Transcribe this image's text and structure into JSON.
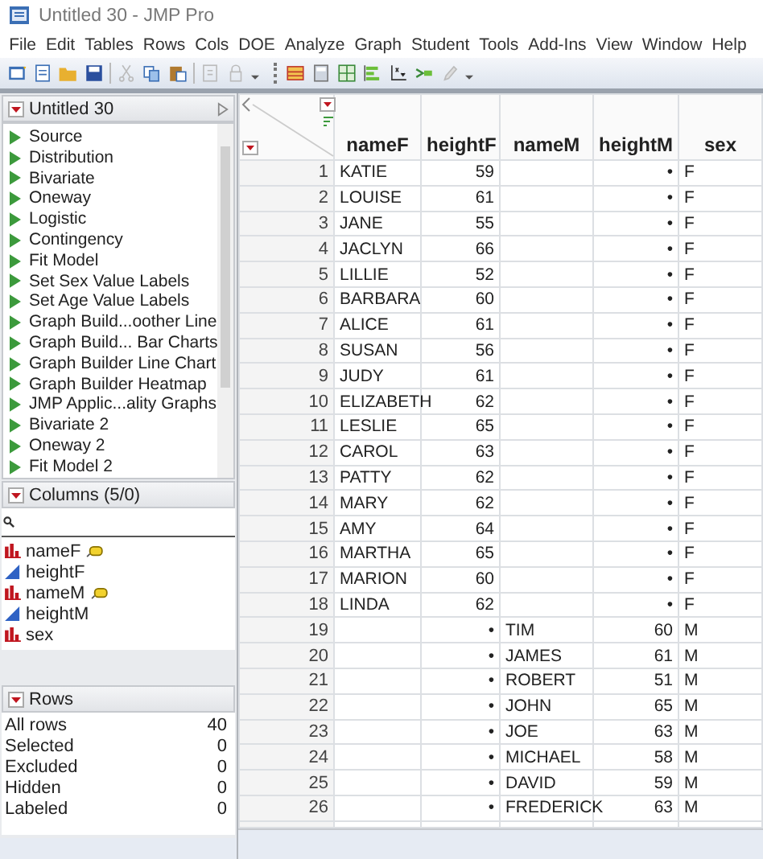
{
  "window": {
    "title": "Untitled 30 - JMP Pro"
  },
  "menu": [
    "File",
    "Edit",
    "Tables",
    "Rows",
    "Cols",
    "DOE",
    "Analyze",
    "Graph",
    "Student",
    "Tools",
    "Add-Ins",
    "View",
    "Window",
    "Help"
  ],
  "table_panel": {
    "title": "Untitled 30",
    "scripts": [
      "Source",
      "Distribution",
      "Bivariate",
      "Oneway",
      "Logistic",
      "Contingency",
      "Fit Model",
      "Set Sex Value Labels",
      "Set Age Value Labels",
      "Graph Build...oother Line",
      "Graph Build... Bar Charts",
      "Graph Builder Line Chart",
      "Graph Builder Heatmap",
      "JMP Applic...ality Graphs",
      "Bivariate 2",
      "Oneway 2",
      "Fit Model 2"
    ]
  },
  "columns_panel": {
    "title": "Columns (5/0)",
    "columns": [
      {
        "name": "nameF",
        "kind": "nominal",
        "label": true
      },
      {
        "name": "heightF",
        "kind": "continuous",
        "label": false
      },
      {
        "name": "nameM",
        "kind": "nominal",
        "label": true
      },
      {
        "name": "heightM",
        "kind": "continuous",
        "label": false
      },
      {
        "name": "sex",
        "kind": "nominal",
        "label": false
      }
    ]
  },
  "rows_panel": {
    "title": "Rows",
    "items": [
      {
        "label": "All rows",
        "count": "40"
      },
      {
        "label": "Selected",
        "count": "0"
      },
      {
        "label": "Excluded",
        "count": "0"
      },
      {
        "label": "Hidden",
        "count": "0"
      },
      {
        "label": "Labeled",
        "count": "0"
      }
    ]
  },
  "table": {
    "columns": [
      "nameF",
      "heightF",
      "nameM",
      "heightM",
      "sex"
    ],
    "rows": [
      {
        "number": "1",
        "cells": [
          "KATIE",
          "59",
          null,
          "•",
          "F"
        ]
      },
      {
        "number": "2",
        "cells": [
          "LOUISE",
          "61",
          null,
          "•",
          "F"
        ]
      },
      {
        "number": "3",
        "cells": [
          "JANE",
          "55",
          null,
          "•",
          "F"
        ]
      },
      {
        "number": "4",
        "cells": [
          "JACLYN",
          "66",
          null,
          "•",
          "F"
        ]
      },
      {
        "number": "5",
        "cells": [
          "LILLIE",
          "52",
          null,
          "•",
          "F"
        ]
      },
      {
        "number": "6",
        "cells": [
          "BARBARA",
          "60",
          null,
          "•",
          "F"
        ]
      },
      {
        "number": "7",
        "cells": [
          "ALICE",
          "61",
          null,
          "•",
          "F"
        ]
      },
      {
        "number": "8",
        "cells": [
          "SUSAN",
          "56",
          null,
          "•",
          "F"
        ]
      },
      {
        "number": "9",
        "cells": [
          "JUDY",
          "61",
          null,
          "•",
          "F"
        ]
      },
      {
        "number": "10",
        "cells": [
          "ELIZABETH",
          "62",
          null,
          "•",
          "F"
        ]
      },
      {
        "number": "11",
        "cells": [
          "LESLIE",
          "65",
          null,
          "•",
          "F"
        ]
      },
      {
        "number": "12",
        "cells": [
          "CAROL",
          "63",
          null,
          "•",
          "F"
        ]
      },
      {
        "number": "13",
        "cells": [
          "PATTY",
          "62",
          null,
          "•",
          "F"
        ]
      },
      {
        "number": "14",
        "cells": [
          "MARY",
          "62",
          null,
          "•",
          "F"
        ]
      },
      {
        "number": "15",
        "cells": [
          "AMY",
          "64",
          null,
          "•",
          "F"
        ]
      },
      {
        "number": "16",
        "cells": [
          "MARTHA",
          "65",
          null,
          "•",
          "F"
        ]
      },
      {
        "number": "17",
        "cells": [
          "MARION",
          "60",
          null,
          "•",
          "F"
        ]
      },
      {
        "number": "18",
        "cells": [
          "LINDA",
          "62",
          null,
          "•",
          "F"
        ]
      },
      {
        "number": "19",
        "cells": [
          null,
          "•",
          "TIM",
          "60",
          "M"
        ]
      },
      {
        "number": "20",
        "cells": [
          null,
          "•",
          "JAMES",
          "61",
          "M"
        ]
      },
      {
        "number": "21",
        "cells": [
          null,
          "•",
          "ROBERT",
          "51",
          "M"
        ]
      },
      {
        "number": "22",
        "cells": [
          null,
          "•",
          "JOHN",
          "65",
          "M"
        ]
      },
      {
        "number": "23",
        "cells": [
          null,
          "•",
          "JOE",
          "63",
          "M"
        ]
      },
      {
        "number": "24",
        "cells": [
          null,
          "•",
          "MICHAEL",
          "58",
          "M"
        ]
      },
      {
        "number": "25",
        "cells": [
          null,
          "•",
          "DAVID",
          "59",
          "M"
        ]
      },
      {
        "number": "26",
        "cells": [
          null,
          "•",
          "FREDERICK",
          "63",
          "M"
        ]
      }
    ]
  }
}
